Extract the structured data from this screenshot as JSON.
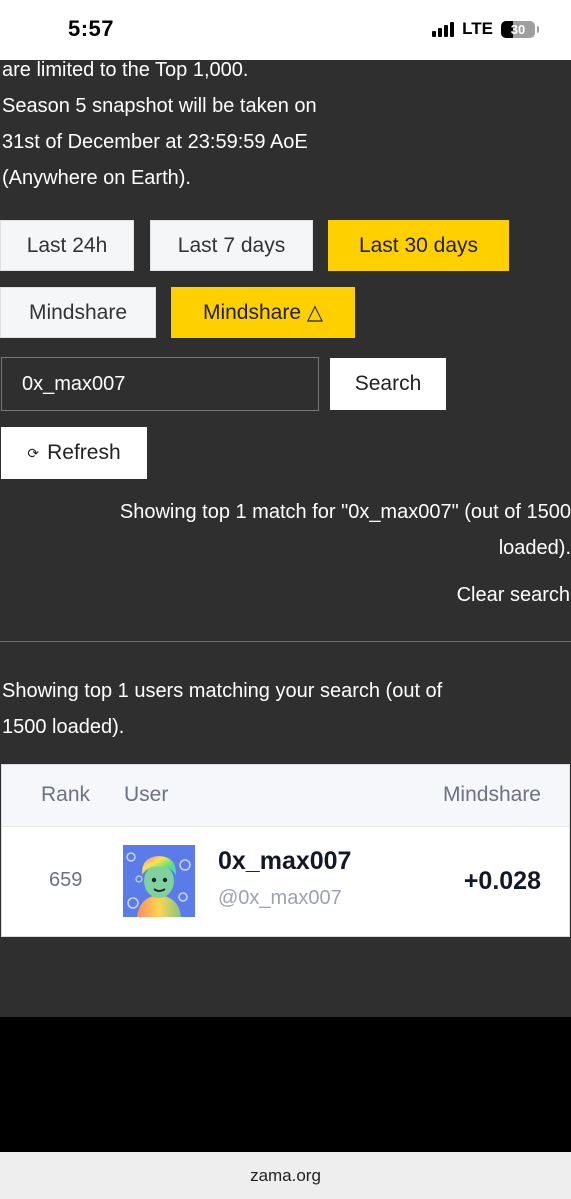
{
  "status_bar": {
    "time": "5:57",
    "network": "LTE",
    "battery": "30"
  },
  "intro": {
    "lines": [
      "are limited to the Top 1,000.",
      "Season 5 snapshot will be taken on",
      "31st of December at 23:59:59 AoE",
      "(Anywhere on Earth)."
    ]
  },
  "time_filters": [
    {
      "label": "Last 24h",
      "active": false
    },
    {
      "label": "Last 7 days",
      "active": false
    },
    {
      "label": "Last 30 days",
      "active": true
    }
  ],
  "metric_filters": [
    {
      "label": "Mindshare",
      "active": false
    },
    {
      "label": "Mindshare △",
      "active": true
    }
  ],
  "search": {
    "value": "0x_max007",
    "button_label": "Search"
  },
  "refresh": {
    "icon": "refresh-icon",
    "glyph": "⟳",
    "label": "Refresh"
  },
  "match_note": {
    "line1": "Showing top 1 match for \"0x_max007\" (out of 1500",
    "line2": "loaded)."
  },
  "clear_search_label": "Clear search",
  "users_note": {
    "line1": "Showing top 1 users matching your search (out of",
    "line2": "1500 loaded)."
  },
  "table": {
    "headers": {
      "rank": "Rank",
      "user": "User",
      "mindshare": "Mindshare"
    },
    "rows": [
      {
        "rank": "659",
        "name": "0x_max007",
        "handle": "@0x_max007",
        "mindshare": "+0.028"
      }
    ]
  },
  "browser": {
    "url": "zama.org"
  },
  "colors": {
    "accent": "#ffd000",
    "background": "#2f2f2f",
    "table_bg": "#ffffff"
  }
}
